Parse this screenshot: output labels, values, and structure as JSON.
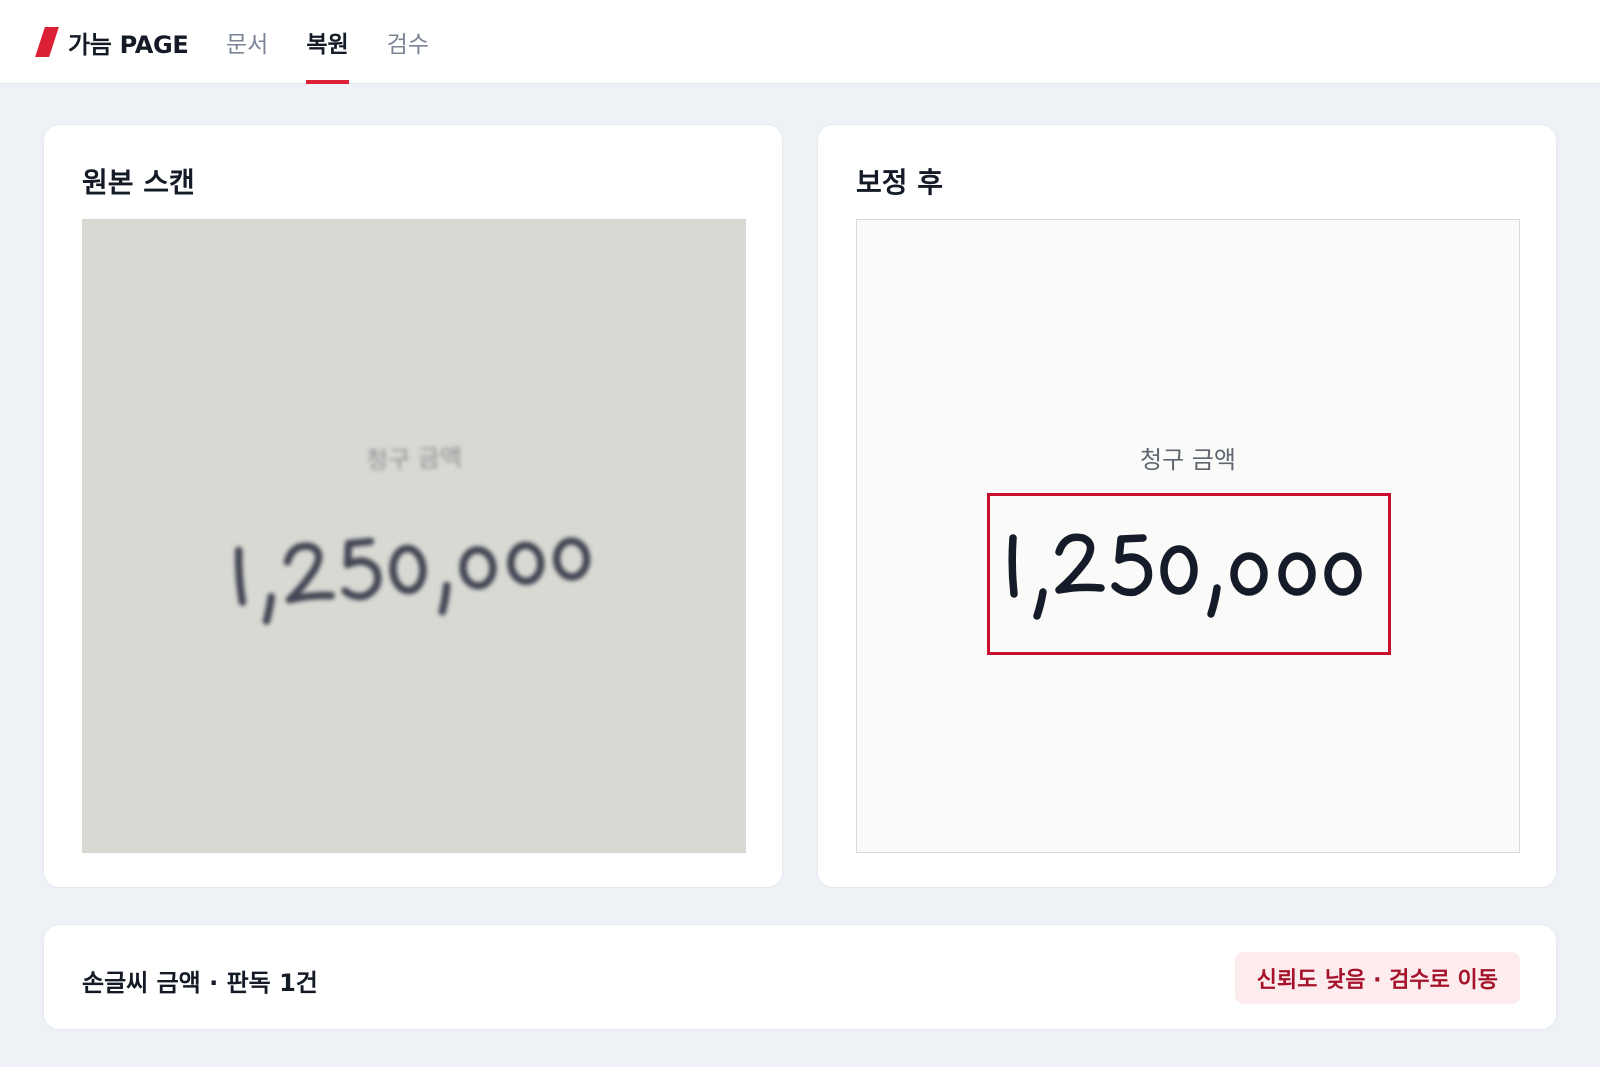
{
  "header": {
    "brand_name": "가늠 PAGE",
    "tabs": [
      {
        "label": "문서",
        "active": false
      },
      {
        "label": "복원",
        "active": true
      },
      {
        "label": "검수",
        "active": false
      }
    ]
  },
  "panels": {
    "original": {
      "title": "원본 스캔",
      "scan_label": "청구 금액",
      "amount": "1,250,000"
    },
    "corrected": {
      "title": "보정 후",
      "scan_label": "청구 금액",
      "amount": "1,250,000"
    }
  },
  "summary": {
    "text": "손글씨 금액 · 판독 1건",
    "review_button_label": "신뢰도 낮음 · 검수로 이동"
  },
  "colors": {
    "accent": "#dc2035",
    "highlight": "#c8102e",
    "ink": "#1a1f2e"
  }
}
